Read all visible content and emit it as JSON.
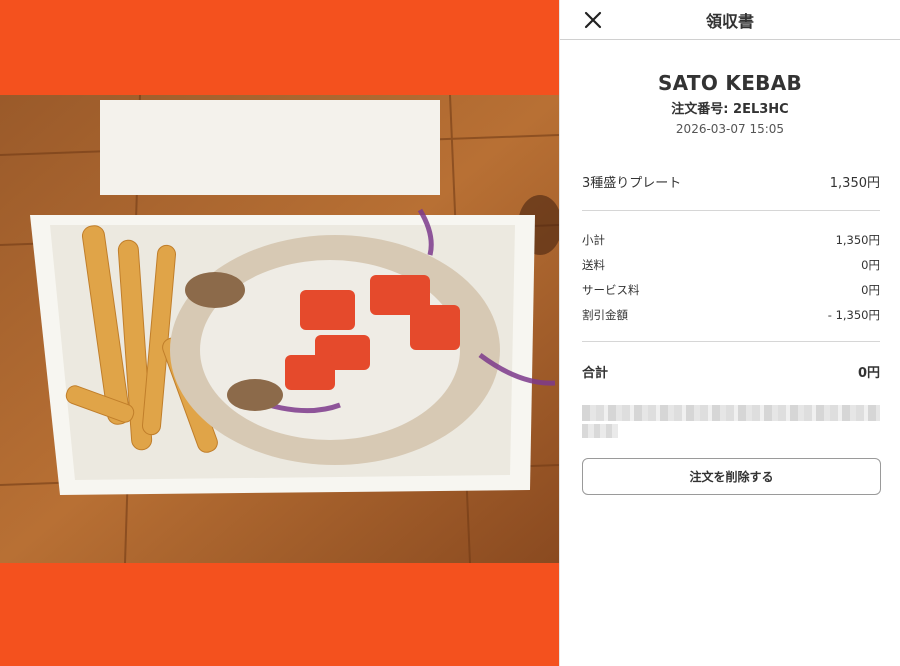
{
  "header": {
    "title": "領収書",
    "close_icon": "close-icon"
  },
  "receipt": {
    "shop_name": "SATO KEBAB",
    "order_number": "注文番号: 2EL3HC",
    "datetime": "2026-03-07 15:05",
    "items": [
      {
        "name": "3種盛りプレート",
        "price": "1,350円"
      }
    ],
    "summary": [
      {
        "label": "小計",
        "value": "1,350円"
      },
      {
        "label": "送料",
        "value": "0円"
      },
      {
        "label": "サービス料",
        "value": "0円"
      },
      {
        "label": "割引金額",
        "value": "- 1,350円"
      }
    ],
    "total": {
      "label": "合計",
      "value": "0円"
    }
  },
  "actions": {
    "delete_label": "注文を削除する"
  },
  "colors": {
    "accent_orange": "#f4511e",
    "divider": "#d6d6d6"
  }
}
